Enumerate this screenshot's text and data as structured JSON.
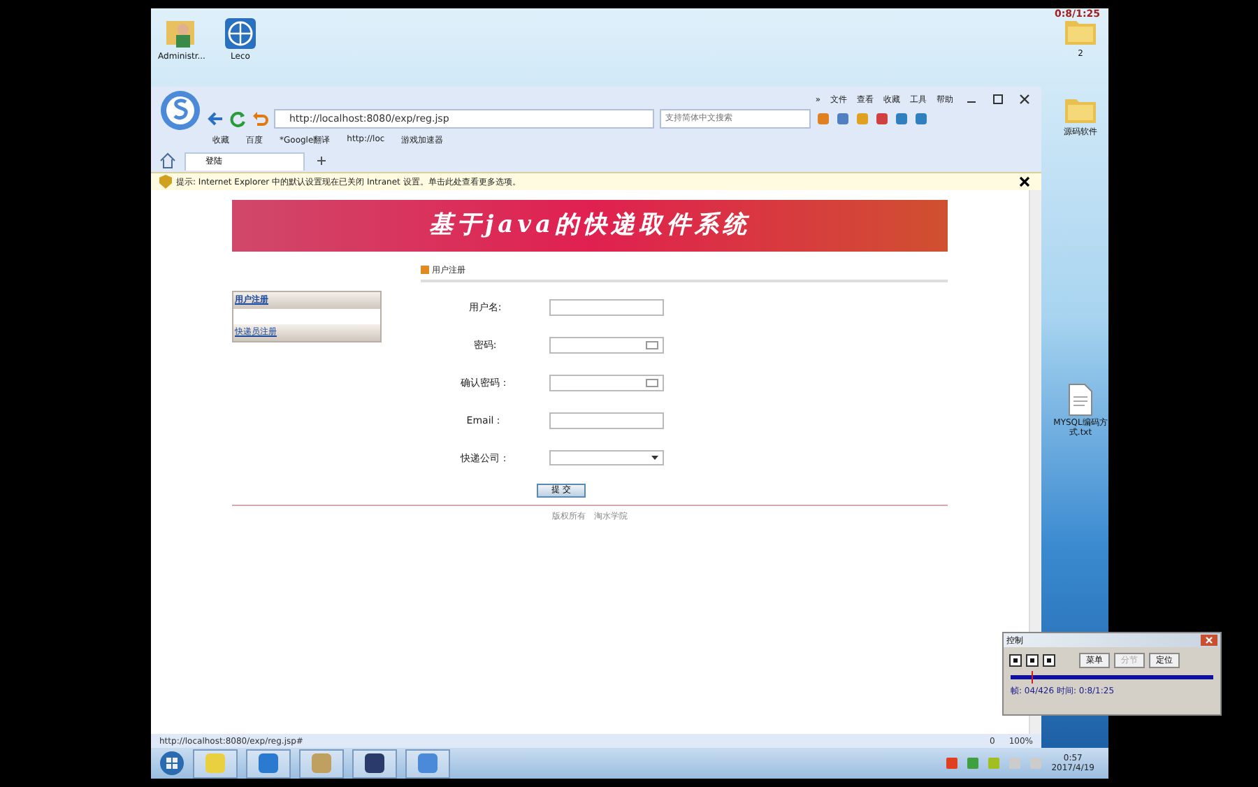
{
  "desktop": {
    "icons_left": [
      {
        "label": "Administr...",
        "kind": "user"
      },
      {
        "label": "Leco",
        "kind": "globe"
      }
    ],
    "icons_right": [
      {
        "label": "2",
        "kind": "folder"
      },
      {
        "label": "源码软件",
        "kind": "folder"
      },
      {
        "label": "MYSQL编码方式.txt",
        "kind": "file"
      }
    ],
    "timer": "0:8/1:25"
  },
  "browser": {
    "menu": [
      "»",
      "文件",
      "查看",
      "收藏",
      "工具",
      "帮助"
    ],
    "address": "http://localhost:8080/exp/reg.jsp",
    "search_placeholder": "支持简体中文搜索",
    "bookmarks": [
      "收藏",
      "百度",
      "*Google翻译",
      "http://loc",
      "游戏加速器"
    ],
    "tabs": [
      {
        "label": "登陆",
        "selected": true
      }
    ],
    "info_bar": "提示: Internet Explorer 中的默认设置现在已关闭 Intranet 设置。单击此处查看更多选项。",
    "status_url": "http://localhost:8080/exp/reg.jsp#",
    "status_count": "0",
    "zoom": "100%"
  },
  "page": {
    "banner": "基于java的快递取件系统",
    "sidebar": [
      {
        "label": "用户注册",
        "selected": true
      },
      {
        "label": "快递员注册",
        "selected": false
      }
    ],
    "section_title": "用户注册",
    "fields": [
      {
        "label": "用户名:",
        "kind": "text"
      },
      {
        "label": "密码:",
        "kind": "password"
      },
      {
        "label": "确认密码：",
        "kind": "password"
      },
      {
        "label": "Email：",
        "kind": "text"
      },
      {
        "label": "快递公司：",
        "kind": "select"
      }
    ],
    "submit": "提 交",
    "footer": [
      "版权所有",
      "淘水学院"
    ]
  },
  "taskbar": {
    "apps": [
      {
        "kind": "folder"
      },
      {
        "kind": "teamviewer"
      },
      {
        "kind": "tool"
      },
      {
        "kind": "editor"
      },
      {
        "kind": "browser"
      }
    ],
    "time": "0:57",
    "date": "2017/4/19"
  },
  "player": {
    "title": "控制",
    "buttons": [
      {
        "label": "菜单",
        "disabled": false
      },
      {
        "label": "分节",
        "disabled": true
      },
      {
        "label": "定位",
        "disabled": false
      }
    ],
    "level": 0.1,
    "info": "帧: 04/426 时间: 0:8/1:25"
  }
}
